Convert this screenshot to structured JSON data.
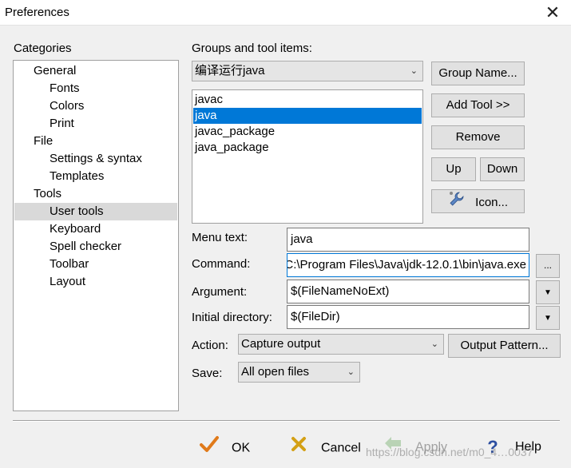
{
  "window": {
    "title": "Preferences",
    "close_glyph": "✕"
  },
  "categories": {
    "label": "Categories",
    "items": [
      {
        "label": "General",
        "level": 1
      },
      {
        "label": "Fonts",
        "level": 2
      },
      {
        "label": "Colors",
        "level": 2
      },
      {
        "label": "Print",
        "level": 2
      },
      {
        "label": "File",
        "level": 1
      },
      {
        "label": "Settings & syntax",
        "level": 2
      },
      {
        "label": "Templates",
        "level": 2
      },
      {
        "label": "Tools",
        "level": 1
      },
      {
        "label": "User tools",
        "level": 2,
        "selected": true
      },
      {
        "label": "Keyboard",
        "level": 2
      },
      {
        "label": "Spell checker",
        "level": 2
      },
      {
        "label": "Toolbar",
        "level": 2
      },
      {
        "label": "Layout",
        "level": 2
      }
    ]
  },
  "groups": {
    "label": "Groups and tool items:",
    "selected_group": "编译运行java",
    "tools": [
      "javac",
      "java",
      "javac_package",
      "java_package"
    ],
    "selected_tool": "java"
  },
  "buttons": {
    "group_name": "Group Name...",
    "add_tool": "Add Tool >>",
    "remove": "Remove",
    "up": "Up",
    "down": "Down",
    "icon": "Icon...",
    "browse": "...",
    "output_pattern": "Output Pattern..."
  },
  "fields": {
    "menu_text_label": "Menu text:",
    "menu_text_value": "java",
    "command_label": "Command:",
    "command_value": "C:\\Program Files\\Java\\jdk-12.0.1\\bin\\java.exe",
    "argument_label": "Argument:",
    "argument_value": "$(FileNameNoExt)",
    "initial_dir_label": "Initial directory:",
    "initial_dir_value": "$(FileDir)",
    "action_label": "Action:",
    "action_value": "Capture output",
    "save_label": "Save:",
    "save_value": "All open files"
  },
  "footer": {
    "ok": "OK",
    "cancel": "Cancel",
    "apply": "Apply",
    "help": "Help"
  },
  "watermark": "https://blog.csdn.net/m0_4…0037"
}
